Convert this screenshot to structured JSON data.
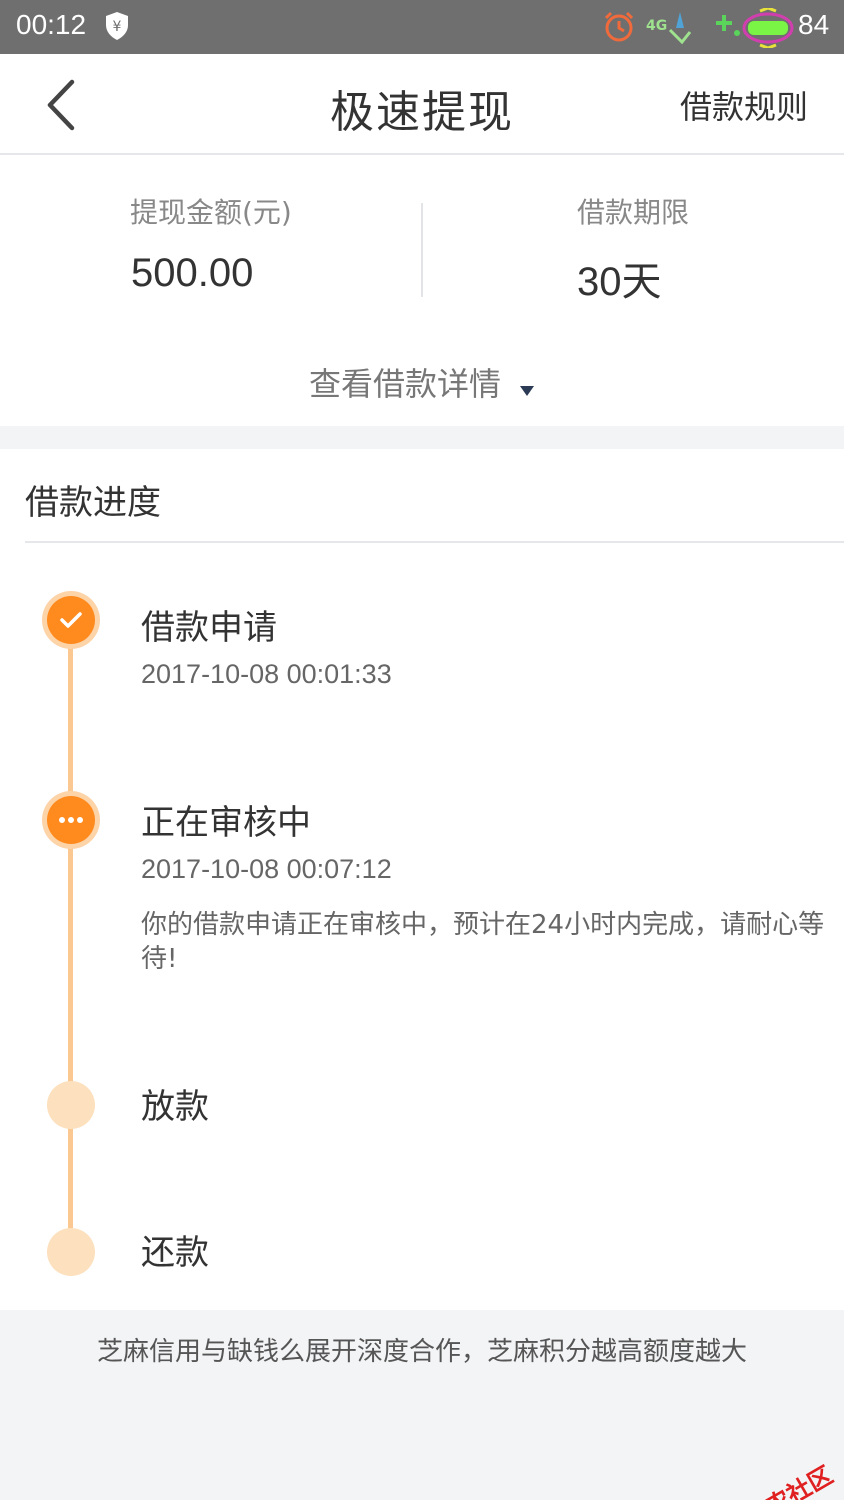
{
  "status_bar": {
    "time": "00:12",
    "battery_level": "84",
    "icons": [
      "yuan-shield-icon",
      "alarm-icon",
      "4g-signal-icon",
      "charging-plus-icon",
      "battery-icon"
    ]
  },
  "nav": {
    "title": "极速提现",
    "rules_label": "借款规则"
  },
  "summary": {
    "amount_label": "提现金额(元)",
    "amount_value": "500.00",
    "term_label": "借款期限",
    "term_value": "30天",
    "details_toggle": "查看借款详情"
  },
  "progress": {
    "title": "借款进度",
    "steps": [
      {
        "title": "借款申请",
        "time": "2017-10-08 00:01:33",
        "status": "done"
      },
      {
        "title": "正在审核中",
        "time": "2017-10-08 00:07:12",
        "note": "你的借款申请正在审核中，预计在24小时内完成，请耐心等待!",
        "status": "active"
      },
      {
        "title": "放款",
        "status": "pending"
      },
      {
        "title": "还款",
        "status": "pending"
      }
    ]
  },
  "footer": {
    "note": "芝麻信用与缺钱么展开深度合作，芝麻积分越高额度越大"
  },
  "watermark": {
    "text": "卡农社区"
  },
  "colors": {
    "accent": "#ff8a1e",
    "timeline": "#fbc892",
    "pending_node": "#fde0bd",
    "status_bar": "#6f6f6f"
  }
}
